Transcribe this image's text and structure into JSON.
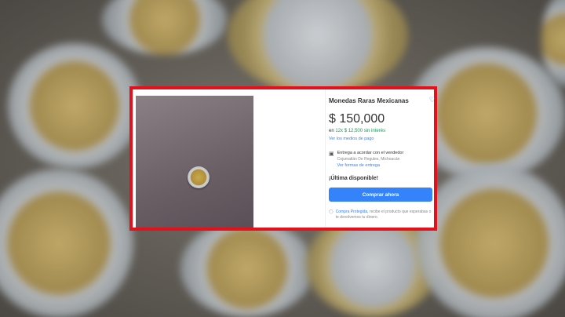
{
  "listing": {
    "title": "Monedas Raras Mexicanas",
    "price": "$ 150,000",
    "installments_prefix": "en",
    "installments_value": "12x $ 12,500 sin interés",
    "payment_link": "Ver los medios de pago",
    "delivery_text": "Entrega a acordar con el vendedor",
    "delivery_location": "Cojumatlán De Regules, Michoacán",
    "shipping_link": "Ver formas de entrega",
    "stock_label": "¡Última disponible!",
    "buy_button": "Comprar ahora",
    "protection_link": "Compra Protegida,",
    "protection_text": "recibe el producto que esperabas o te devolvemos tu dinero."
  },
  "icons": {
    "favorite": "heart-icon",
    "delivery": "truck-icon",
    "protection": "shield-icon"
  },
  "colors": {
    "frame": "#e3111b",
    "accent": "#3483fa",
    "green": "#00a650"
  }
}
